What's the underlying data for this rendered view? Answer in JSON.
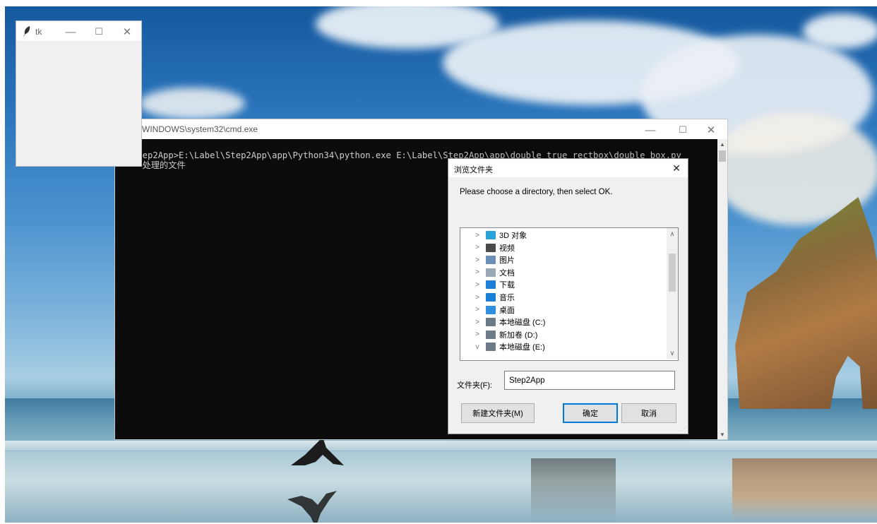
{
  "cmd": {
    "title": "WINDOWS\\system32\\cmd.exe",
    "line1": "el\\Step2App>E:\\Label\\Step2App\\app\\Python34\\python.exe E:\\Label\\Step2App\\app\\double_true_rectbox\\double_box.py",
    "line2": "     处理的文件",
    "minimize": "—",
    "maximize": "☐",
    "close": "✕"
  },
  "tk": {
    "title": "tk",
    "minimize": "—",
    "maximize": "☐",
    "close": "✕"
  },
  "dialog": {
    "title": "浏览文件夹",
    "close": "✕",
    "message": "Please choose a directory, then select OK.",
    "tree_items": [
      {
        "chevron": ">",
        "label": "3D 对象",
        "icon": "3d-objects-icon",
        "color": "#2aa4d8"
      },
      {
        "chevron": ">",
        "label": "视频",
        "icon": "video-icon",
        "color": "#4a4a4a"
      },
      {
        "chevron": ">",
        "label": "图片",
        "icon": "pictures-icon",
        "color": "#6b8fb3"
      },
      {
        "chevron": ">",
        "label": "文档",
        "icon": "documents-icon",
        "color": "#9aa7b4"
      },
      {
        "chevron": ">",
        "label": "下载",
        "icon": "download-icon",
        "color": "#1f7ed8"
      },
      {
        "chevron": ">",
        "label": "音乐",
        "icon": "music-icon",
        "color": "#1a7fd6"
      },
      {
        "chevron": ">",
        "label": "桌面",
        "icon": "desktop-icon",
        "color": "#2f8fdc"
      },
      {
        "chevron": ">",
        "label": "本地磁盘 (C:)",
        "icon": "system-drive-icon",
        "color": "#6b7a86"
      },
      {
        "chevron": ">",
        "label": "新加卷 (D:)",
        "icon": "drive-icon",
        "color": "#6b7a86"
      },
      {
        "chevron": "v",
        "label": "本地磁盘 (E:)",
        "icon": "drive-icon",
        "color": "#6b7a86"
      }
    ],
    "folder_label": "文件夹(F):",
    "folder_value": "Step2App",
    "new_folder_button": "新建文件夹(M)",
    "ok_button": "确定",
    "cancel_button": "取消"
  }
}
